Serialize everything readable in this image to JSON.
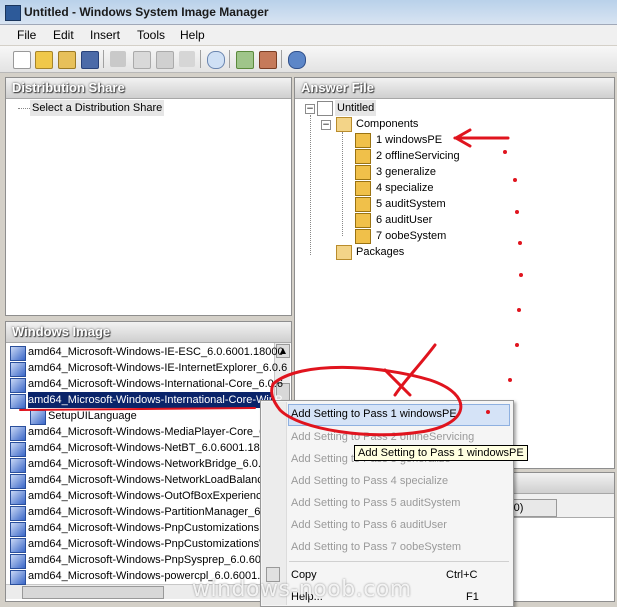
{
  "window": {
    "title": "Untitled - Windows System Image Manager"
  },
  "menu": [
    "File",
    "Edit",
    "Insert",
    "Tools",
    "Help"
  ],
  "toolbar_icons": [
    "new-icon",
    "open-icon",
    "open-folder-icon",
    "save-icon",
    "cut-icon",
    "copy-icon",
    "paste-icon",
    "delete-icon",
    "search-icon",
    "validate-icon",
    "package-icon",
    "help-icon"
  ],
  "distribution_share": {
    "header": "Distribution Share",
    "item": "Select a Distribution Share"
  },
  "answer_file": {
    "header": "Answer File",
    "root": "Untitled",
    "components": "Components",
    "passes": [
      "1 windowsPE",
      "2 offlineServicing",
      "3 generalize",
      "4 specialize",
      "5 auditSystem",
      "6 auditUser",
      "7 oobeSystem"
    ],
    "packages": "Packages"
  },
  "windows_image": {
    "header": "Windows Image",
    "items": [
      "amd64_Microsoft-Windows-IE-ESC_6.0.6001.18000",
      "amd64_Microsoft-Windows-IE-InternetExplorer_6.0.6",
      "amd64_Microsoft-Windows-International-Core_6.0.6",
      "amd64_Microsoft-Windows-International-Core-WinP",
      "SetupUILanguage",
      "amd64_Microsoft-Windows-MediaPlayer-Core_6",
      "amd64_Microsoft-Windows-NetBT_6.0.6001.18",
      "amd64_Microsoft-Windows-NetworkBridge_6.0.",
      "amd64_Microsoft-Windows-NetworkLoadBalanc",
      "amd64_Microsoft-Windows-OutOfBoxExperience",
      "amd64_Microsoft-Windows-PartitionManager_6.",
      "amd64_Microsoft-Windows-PnpCustomizationsN",
      "amd64_Microsoft-Windows-PnpCustomizationsW",
      "amd64_Microsoft-Windows-PnpSysprep_6.0.600",
      "amd64_Microsoft-Windows-powercpl_6.0.6001."
    ]
  },
  "context_menu": {
    "items": [
      "Add Setting to Pass 1 windowsPE",
      "Add Setting to Pass 2 offlineServicing",
      "Add Setting to Pass 3 generalize",
      "Add Setting to Pass 4 specialize",
      "Add Setting to Pass 5 auditSystem",
      "Add Setting to Pass 6 auditUser",
      "Add Setting to Pass 7 oobeSystem"
    ],
    "copy": "Copy",
    "copy_shortcut": "Ctrl+C",
    "help": "Help...",
    "help_shortcut": "F1"
  },
  "tooltip": "Add Setting to Pass 1 windowsPE",
  "partial_tab": "(0)",
  "watermark": "windows-noob.com",
  "colors": {
    "annotation": "#e0141e",
    "selection": "#0a246a"
  }
}
